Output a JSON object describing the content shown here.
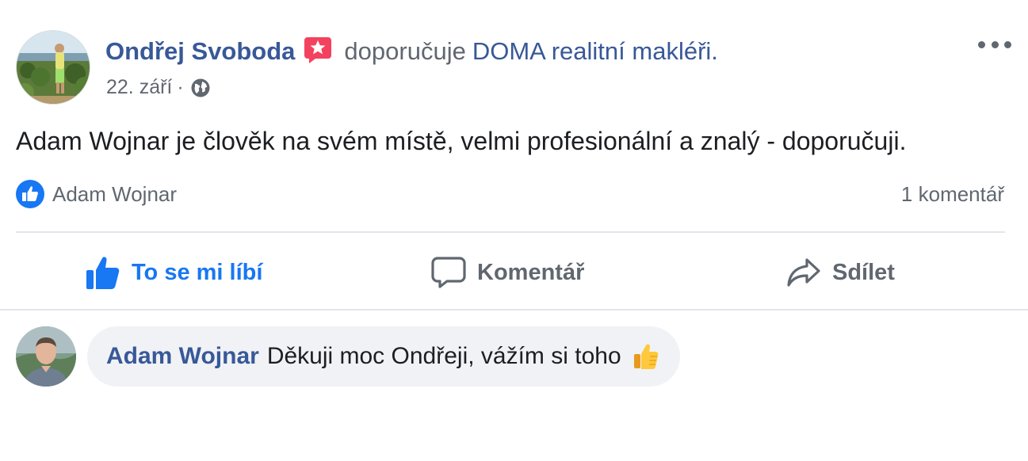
{
  "post": {
    "author": "Ondřej Svoboda",
    "action_text": "doporučuje",
    "page_name": "DOMA realitní makléři.",
    "date": "22. září",
    "separator": "·",
    "body": "Adam Wojnar je člověk na svém místě, velmi profesionální a znalý - doporučuji.",
    "liked_by": "Adam Wojnar",
    "comment_count": "1 komentář"
  },
  "actions": {
    "like_label": "To se mi líbí",
    "comment_label": "Komentář",
    "share_label": "Sdílet"
  },
  "comment": {
    "author": "Adam Wojnar",
    "text": "Děkuji moc Ondřeji, vážím si toho"
  },
  "icons": {
    "recommendation": "recommendation-star-badge-icon",
    "privacy": "globe-icon",
    "more": "more-options-icon",
    "reaction": "like-reaction-icon",
    "like": "thumbs-up-icon",
    "comment": "speech-bubble-icon",
    "share": "share-arrow-icon",
    "emoji": "thumbs-up-emoji-icon"
  },
  "colors": {
    "link": "#385898",
    "like_active": "#1877f2",
    "secondary_text": "#606770",
    "recommendation_badge": "#f3425f",
    "bubble_bg": "#f0f2f5"
  }
}
